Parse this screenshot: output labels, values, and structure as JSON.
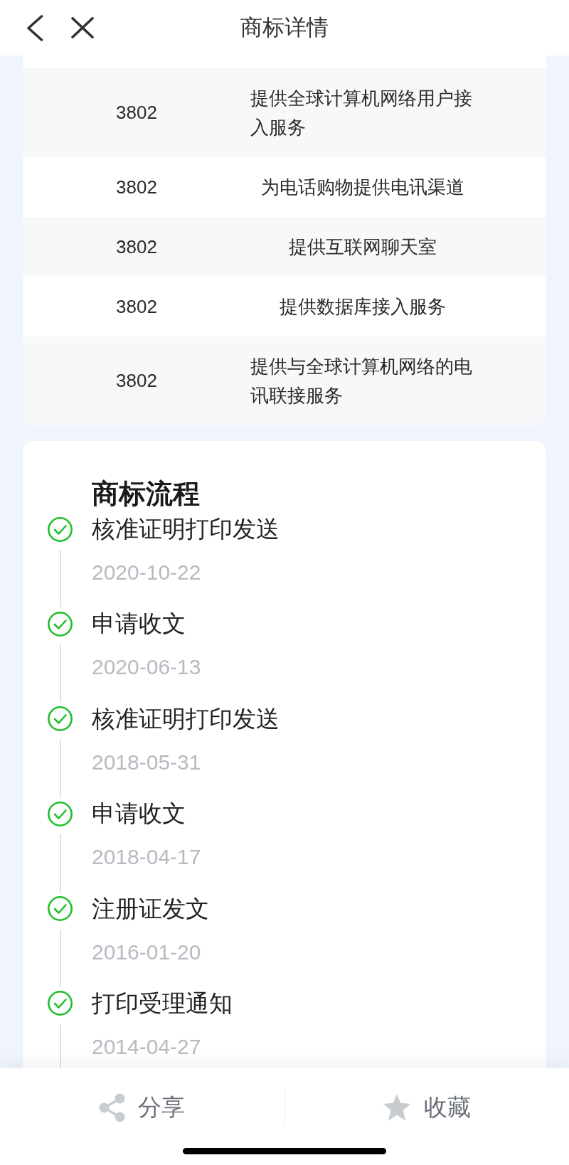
{
  "header": {
    "title": "商标详情"
  },
  "services_table": {
    "rows": [
      {
        "class_code": "3802",
        "service": "提供全球计算机网络用户接入服务"
      },
      {
        "class_code": "3802",
        "service": "为电话购物提供电讯渠道"
      },
      {
        "class_code": "3802",
        "service": "提供互联网聊天室"
      },
      {
        "class_code": "3802",
        "service": "提供数据库接入服务"
      },
      {
        "class_code": "3802",
        "service": "提供与全球计算机网络的电讯联接服务"
      }
    ]
  },
  "process": {
    "title": "商标流程",
    "steps": [
      {
        "name": "核准证明打印发送",
        "date": "2020-10-22",
        "completed": true
      },
      {
        "name": "申请收文",
        "date": "2020-06-13",
        "completed": true
      },
      {
        "name": "核准证明打印发送",
        "date": "2018-05-31",
        "completed": true
      },
      {
        "name": "申请收文",
        "date": "2018-04-17",
        "completed": true
      },
      {
        "name": "注册证发文",
        "date": "2016-01-20",
        "completed": true
      },
      {
        "name": "打印受理通知",
        "date": "2014-04-27",
        "completed": true
      }
    ]
  },
  "bottom_bar": {
    "actions": [
      {
        "kind": "share",
        "label": "分享"
      },
      {
        "kind": "favorite",
        "label": "收藏"
      }
    ]
  }
}
